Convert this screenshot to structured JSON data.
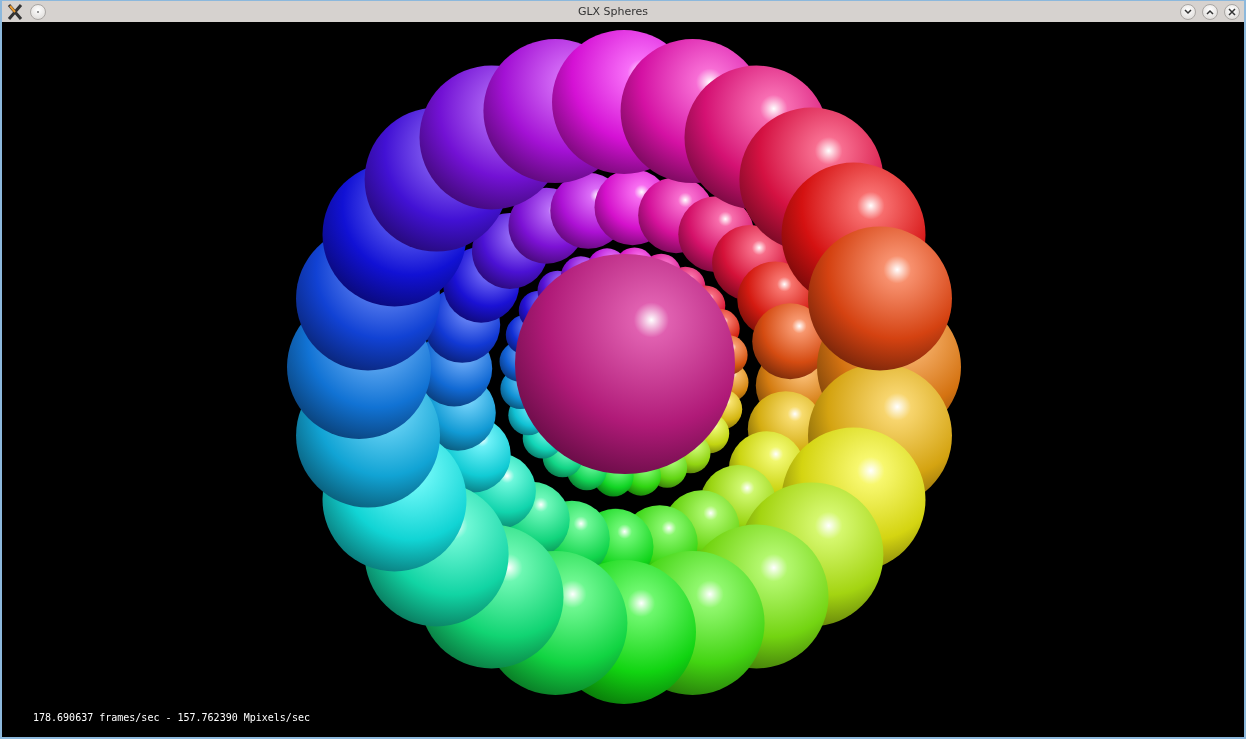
{
  "window": {
    "title": "GLX Spheres"
  },
  "status_text": "178.690637 frames/sec - 157.762390 Mpixels/sec"
}
